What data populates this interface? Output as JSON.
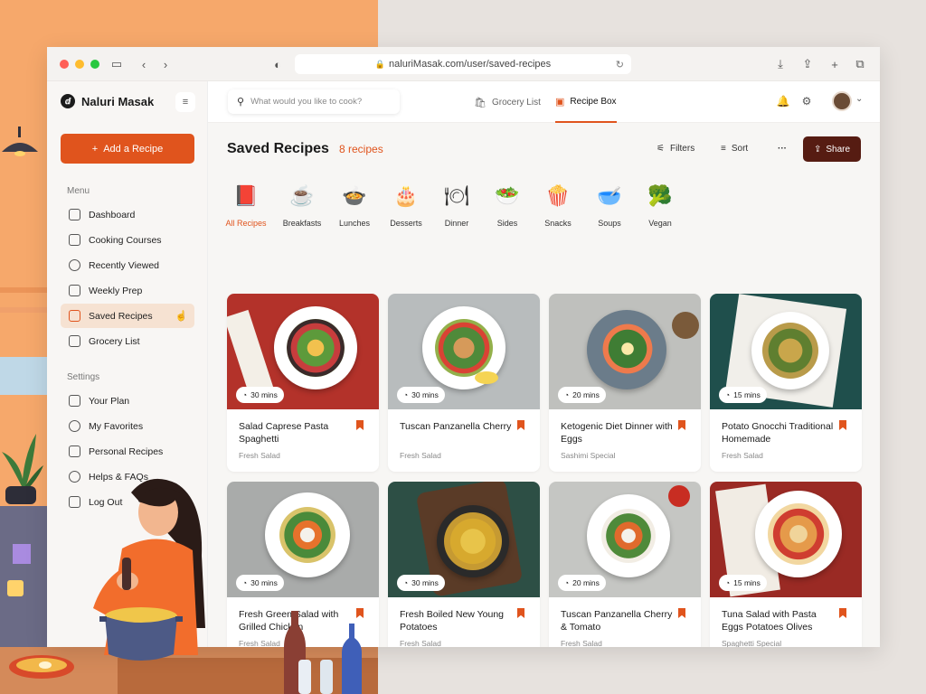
{
  "browser": {
    "url": "naluriMasak.com/user/saved-recipes"
  },
  "app": {
    "name": "Naluri Masak"
  },
  "sidebar": {
    "add_label": "Add a Recipe",
    "menu_label": "Menu",
    "settings_label": "Settings",
    "menu_items": [
      {
        "label": "Dashboard",
        "icon": "dashboard-icon"
      },
      {
        "label": "Cooking Courses",
        "icon": "courses-icon"
      },
      {
        "label": "Recently Viewed",
        "icon": "history-icon"
      },
      {
        "label": "Weekly Prep",
        "icon": "calendar-icon"
      },
      {
        "label": "Saved Recipes",
        "icon": "bookmark-icon"
      },
      {
        "label": "Grocery List",
        "icon": "grocery-icon"
      }
    ],
    "settings_items": [
      {
        "label": "Your Plan",
        "icon": "plan-icon"
      },
      {
        "label": "My Favorites",
        "icon": "heart-icon"
      },
      {
        "label": "Personal Recipes",
        "icon": "book-icon"
      },
      {
        "label": "Helps & FAQs",
        "icon": "help-icon"
      },
      {
        "label": "Log Out",
        "icon": "logout-icon"
      }
    ]
  },
  "header": {
    "search_placeholder": "What would you like to cook?",
    "tabs": [
      {
        "label": "Grocery List",
        "icon": "grocery-bag-icon"
      },
      {
        "label": "Recipe Box",
        "icon": "recipe-box-icon"
      }
    ]
  },
  "main": {
    "title": "Saved Recipes",
    "count": "8 recipes",
    "filters_label": "Filters",
    "sort_label": "Sort",
    "share_label": "Share",
    "categories": [
      {
        "label": "All Recipes",
        "icon": "recipe-book-icon"
      },
      {
        "label": "Breakfasts",
        "icon": "breakfast-icon"
      },
      {
        "label": "Lunches",
        "icon": "lunch-icon"
      },
      {
        "label": "Desserts",
        "icon": "dessert-icon"
      },
      {
        "label": "Dinner",
        "icon": "dinner-icon"
      },
      {
        "label": "Sides",
        "icon": "sides-icon"
      },
      {
        "label": "Snacks",
        "icon": "snacks-icon"
      },
      {
        "label": "Soups",
        "icon": "soup-icon"
      },
      {
        "label": "Vegan",
        "icon": "vegan-icon"
      }
    ],
    "recipes": [
      {
        "title": "Salad Caprese Pasta Spaghetti",
        "subtitle": "Fresh Salad",
        "time": "30 mins"
      },
      {
        "title": "Tuscan Panzanella Cherry",
        "subtitle": "Fresh Salad",
        "time": "30 mins"
      },
      {
        "title": "Ketogenic Diet Dinner with Eggs",
        "subtitle": "Sashimi Special",
        "time": "20 mins"
      },
      {
        "title": "Potato Gnocchi Traditional Homemade",
        "subtitle": "Fresh Salad",
        "time": "15 mins"
      },
      {
        "title": "Fresh Green Salad with Grilled Chicken",
        "subtitle": "Fresh Salad",
        "time": "30 mins"
      },
      {
        "title": "Fresh Boiled New Young Potatoes",
        "subtitle": "Fresh Salad",
        "time": "30 mins"
      },
      {
        "title": "Tuscan Panzanella Cherry & Tomato",
        "subtitle": "Fresh Salad",
        "time": "20 mins"
      },
      {
        "title": "Tuna Salad with Pasta Eggs Potatoes Olives",
        "subtitle": "Spaghetti Special",
        "time": "15 mins"
      }
    ]
  },
  "colors": {
    "accent": "#e0541d",
    "share": "#561c12",
    "active_bg": "#f6e2d2"
  }
}
